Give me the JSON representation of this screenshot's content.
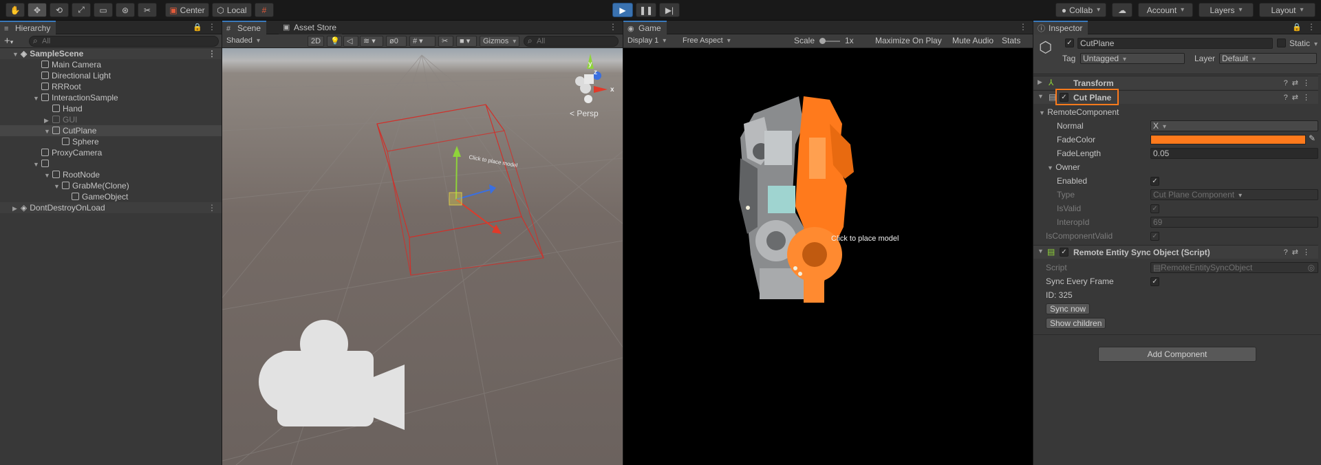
{
  "toolbar": {
    "pivot": "Center",
    "space": "Local",
    "collab": "Collab",
    "account": "Account",
    "layers": "Layers",
    "layout": "Layout"
  },
  "hierarchy": {
    "tab": "Hierarchy",
    "search_placeholder": "All",
    "add": "+",
    "items": [
      {
        "label": "SampleScene",
        "depth": 0
      },
      {
        "label": "Main Camera",
        "depth": 1
      },
      {
        "label": "Directional Light",
        "depth": 1
      },
      {
        "label": "RRRoot",
        "depth": 1
      },
      {
        "label": "InteractionSample",
        "depth": 1
      },
      {
        "label": "Hand",
        "depth": 2
      },
      {
        "label": "GUI",
        "depth": 2
      },
      {
        "label": "CutPlane",
        "depth": 2
      },
      {
        "label": "Sphere",
        "depth": 3
      },
      {
        "label": "ProxyCamera",
        "depth": 1
      },
      {
        "label": "",
        "depth": 1
      },
      {
        "label": "RootNode",
        "depth": 2
      },
      {
        "label": "GrabMe(Clone)",
        "depth": 3
      },
      {
        "label": "GameObject",
        "depth": 4
      },
      {
        "label": "DontDestroyOnLoad",
        "depth": 0
      }
    ]
  },
  "scene": {
    "tab_scene": "Scene",
    "tab_store": "Asset Store",
    "shading": "Shaded",
    "mode2d": "2D",
    "hidden_count": "0",
    "gizmos": "Gizmos",
    "search_placeholder": "All",
    "persp": "< Persp",
    "label_text": "Click to place model",
    "axis_y": "y",
    "axis_z": "z",
    "axis_x": "x"
  },
  "game": {
    "tab": "Game",
    "display": "Display 1",
    "aspect": "Free Aspect",
    "scale_label": "Scale",
    "scale_value": "1x",
    "maximize": "Maximize On Play",
    "mute": "Mute Audio",
    "stats": "Stats",
    "overlay_text": "Click to place model"
  },
  "inspector": {
    "tab": "Inspector",
    "object_name": "CutPlane",
    "static": "Static",
    "tag_label": "Tag",
    "tag_value": "Untagged",
    "layer_label": "Layer",
    "layer_value": "Default",
    "transform": "Transform",
    "cutplane_title": "Cut Plane",
    "remote_component": "RemoteComponent",
    "normal_label": "Normal",
    "normal_value": "X",
    "fade_color_label": "FadeColor",
    "fade_color": "#ff7a1c",
    "fade_length_label": "FadeLength",
    "fade_length_value": "0.05",
    "owner_label": "Owner",
    "enabled_label": "Enabled",
    "type_label": "Type",
    "type_value": "Cut Plane Component",
    "isvalid_label": "IsValid",
    "interopid_label": "InteropId",
    "interopid_value": "69",
    "iscomponentvalid_label": "IsComponentValid",
    "sync_title": "Remote Entity Sync Object (Script)",
    "script_label": "Script",
    "script_value": "RemoteEntitySyncObject",
    "sync_every_frame_label": "Sync Every Frame",
    "id_text": "ID: 325",
    "sync_now": "Sync now",
    "show_children": "Show children",
    "add_component": "Add Component"
  }
}
